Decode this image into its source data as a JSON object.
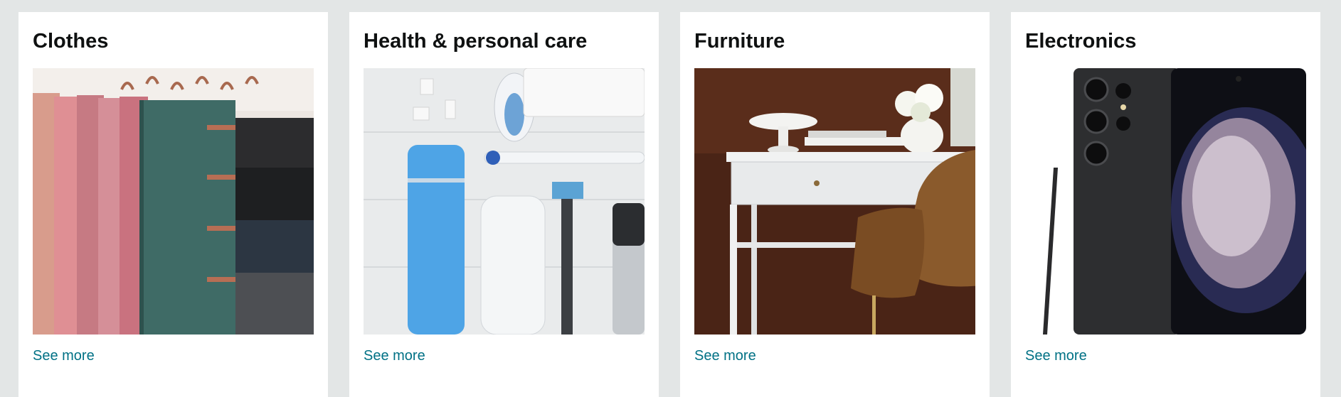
{
  "cards": [
    {
      "title": "Clothes",
      "image": "clothes-on-hangers-photo",
      "link_label": "See more"
    },
    {
      "title": "Health & personal care",
      "image": "personal-care-products-photo",
      "link_label": "See more"
    },
    {
      "title": "Furniture",
      "image": "desk-and-chair-photo",
      "link_label": "See more"
    },
    {
      "title": "Electronics",
      "image": "smartphone-with-stylus-photo",
      "link_label": "See more"
    }
  ],
  "colors": {
    "page_background": "#e3e6e6",
    "card_background": "#ffffff",
    "title_text": "#0f1111",
    "link_text": "#007185"
  }
}
